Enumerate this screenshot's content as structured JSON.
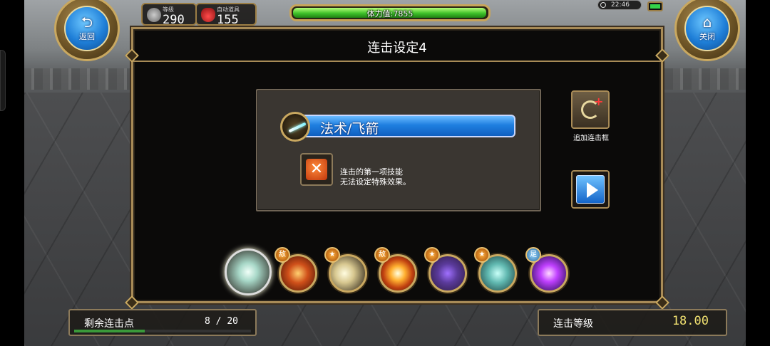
{
  "hud": {
    "back_label": "返回",
    "close_label": "关闭",
    "level_caption": "等级",
    "level_value": "290",
    "potion_caption": "自动道具",
    "potion_value": "155",
    "stamina_text": "体力值:7855",
    "stamina_fraction": 0.99,
    "clock": "22:46"
  },
  "modal": {
    "title": "连击设定4",
    "selected_skill": "法术/飞箭",
    "note_line1": "连击的第一项技能",
    "note_line2": "无法设定特殊效果。",
    "add_frame_label": "追加连击框"
  },
  "skills": [
    {
      "name": "arrow-skill-icon",
      "badge": ""
    },
    {
      "name": "fire-skill-icon",
      "badge": "敌"
    },
    {
      "name": "light-skill-icon",
      "badge": "★"
    },
    {
      "name": "burst-skill-icon",
      "badge": "敌"
    },
    {
      "name": "shadow-skill-icon",
      "badge": "★"
    },
    {
      "name": "cyan-skill-icon",
      "badge": "★"
    },
    {
      "name": "purple-skill-icon",
      "badge": "足"
    }
  ],
  "bottom": {
    "remain_label": "剩余连击点",
    "remain_value": "8 / 20",
    "remain_fraction": 0.4,
    "combo_level_label": "连击等级",
    "combo_level_value": "18.00"
  },
  "colors": {
    "gold": "#c9a860",
    "accent_blue": "#1f7fe0",
    "stamina_green": "#3ec12a"
  }
}
